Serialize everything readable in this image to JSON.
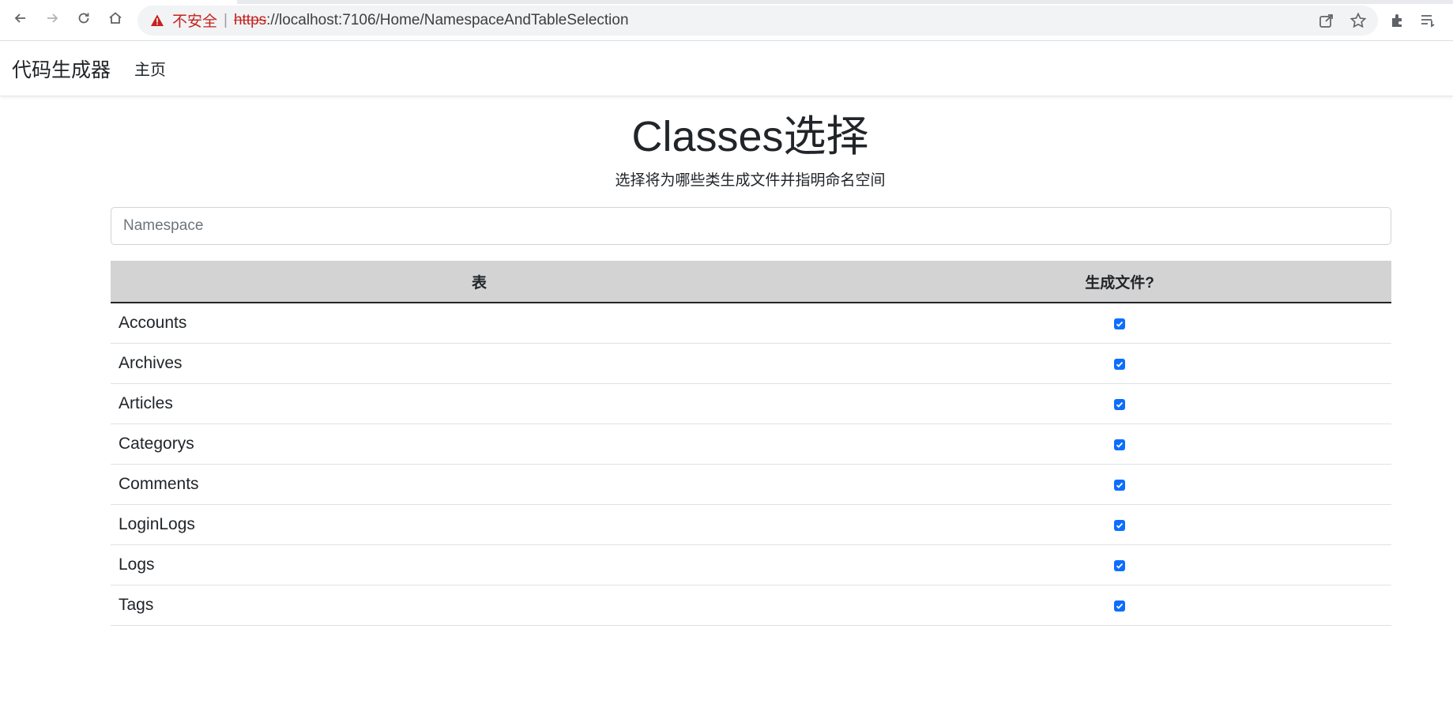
{
  "browser": {
    "security_label": "不安全",
    "separator": "|",
    "url_scheme": "https",
    "url_rest": "://localhost:7106/Home/NamespaceAndTableSelection",
    "icons": [
      "back-icon",
      "forward-icon",
      "reload-icon",
      "home-icon",
      "warning-icon",
      "share-icon",
      "star-icon",
      "extensions-icon",
      "reading-list-icon"
    ]
  },
  "navbar": {
    "brand": "代码生成器",
    "home_link": "主页"
  },
  "main": {
    "title": "Classes选择",
    "subtitle": "选择将为哪些类生成文件并指明命名空间",
    "namespace_placeholder": "Namespace",
    "namespace_value": ""
  },
  "table": {
    "headers": [
      "表",
      "生成文件?"
    ],
    "rows": [
      {
        "name": "Accounts",
        "checked": true
      },
      {
        "name": "Archives",
        "checked": true
      },
      {
        "name": "Articles",
        "checked": true
      },
      {
        "name": "Categorys",
        "checked": true
      },
      {
        "name": "Comments",
        "checked": true
      },
      {
        "name": "LoginLogs",
        "checked": true
      },
      {
        "name": "Logs",
        "checked": true
      },
      {
        "name": "Tags",
        "checked": true
      }
    ]
  },
  "colors": {
    "accent": "#0d6efd",
    "header_bg": "#d3d3d3",
    "warning_red": "#c5221f"
  }
}
